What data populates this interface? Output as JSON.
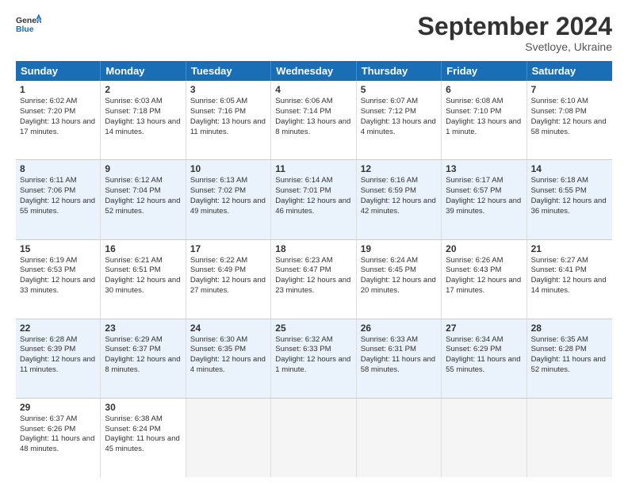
{
  "header": {
    "logo_text_general": "General",
    "logo_text_blue": "Blue",
    "month_title": "September 2024",
    "subtitle": "Svetloye, Ukraine"
  },
  "calendar": {
    "days_of_week": [
      "Sunday",
      "Monday",
      "Tuesday",
      "Wednesday",
      "Thursday",
      "Friday",
      "Saturday"
    ],
    "rows": [
      [
        {
          "day": "1",
          "info": "Sunrise: 6:02 AM\nSunset: 7:20 PM\nDaylight: 13 hours and 17 minutes."
        },
        {
          "day": "2",
          "info": "Sunrise: 6:03 AM\nSunset: 7:18 PM\nDaylight: 13 hours and 14 minutes."
        },
        {
          "day": "3",
          "info": "Sunrise: 6:05 AM\nSunset: 7:16 PM\nDaylight: 13 hours and 11 minutes."
        },
        {
          "day": "4",
          "info": "Sunrise: 6:06 AM\nSunset: 7:14 PM\nDaylight: 13 hours and 8 minutes."
        },
        {
          "day": "5",
          "info": "Sunrise: 6:07 AM\nSunset: 7:12 PM\nDaylight: 13 hours and 4 minutes."
        },
        {
          "day": "6",
          "info": "Sunrise: 6:08 AM\nSunset: 7:10 PM\nDaylight: 13 hours and 1 minute."
        },
        {
          "day": "7",
          "info": "Sunrise: 6:10 AM\nSunset: 7:08 PM\nDaylight: 12 hours and 58 minutes."
        }
      ],
      [
        {
          "day": "8",
          "info": "Sunrise: 6:11 AM\nSunset: 7:06 PM\nDaylight: 12 hours and 55 minutes."
        },
        {
          "day": "9",
          "info": "Sunrise: 6:12 AM\nSunset: 7:04 PM\nDaylight: 12 hours and 52 minutes."
        },
        {
          "day": "10",
          "info": "Sunrise: 6:13 AM\nSunset: 7:02 PM\nDaylight: 12 hours and 49 minutes."
        },
        {
          "day": "11",
          "info": "Sunrise: 6:14 AM\nSunset: 7:01 PM\nDaylight: 12 hours and 46 minutes."
        },
        {
          "day": "12",
          "info": "Sunrise: 6:16 AM\nSunset: 6:59 PM\nDaylight: 12 hours and 42 minutes."
        },
        {
          "day": "13",
          "info": "Sunrise: 6:17 AM\nSunset: 6:57 PM\nDaylight: 12 hours and 39 minutes."
        },
        {
          "day": "14",
          "info": "Sunrise: 6:18 AM\nSunset: 6:55 PM\nDaylight: 12 hours and 36 minutes."
        }
      ],
      [
        {
          "day": "15",
          "info": "Sunrise: 6:19 AM\nSunset: 6:53 PM\nDaylight: 12 hours and 33 minutes."
        },
        {
          "day": "16",
          "info": "Sunrise: 6:21 AM\nSunset: 6:51 PM\nDaylight: 12 hours and 30 minutes."
        },
        {
          "day": "17",
          "info": "Sunrise: 6:22 AM\nSunset: 6:49 PM\nDaylight: 12 hours and 27 minutes."
        },
        {
          "day": "18",
          "info": "Sunrise: 6:23 AM\nSunset: 6:47 PM\nDaylight: 12 hours and 23 minutes."
        },
        {
          "day": "19",
          "info": "Sunrise: 6:24 AM\nSunset: 6:45 PM\nDaylight: 12 hours and 20 minutes."
        },
        {
          "day": "20",
          "info": "Sunrise: 6:26 AM\nSunset: 6:43 PM\nDaylight: 12 hours and 17 minutes."
        },
        {
          "day": "21",
          "info": "Sunrise: 6:27 AM\nSunset: 6:41 PM\nDaylight: 12 hours and 14 minutes."
        }
      ],
      [
        {
          "day": "22",
          "info": "Sunrise: 6:28 AM\nSunset: 6:39 PM\nDaylight: 12 hours and 11 minutes."
        },
        {
          "day": "23",
          "info": "Sunrise: 6:29 AM\nSunset: 6:37 PM\nDaylight: 12 hours and 8 minutes."
        },
        {
          "day": "24",
          "info": "Sunrise: 6:30 AM\nSunset: 6:35 PM\nDaylight: 12 hours and 4 minutes."
        },
        {
          "day": "25",
          "info": "Sunrise: 6:32 AM\nSunset: 6:33 PM\nDaylight: 12 hours and 1 minute."
        },
        {
          "day": "26",
          "info": "Sunrise: 6:33 AM\nSunset: 6:31 PM\nDaylight: 11 hours and 58 minutes."
        },
        {
          "day": "27",
          "info": "Sunrise: 6:34 AM\nSunset: 6:29 PM\nDaylight: 11 hours and 55 minutes."
        },
        {
          "day": "28",
          "info": "Sunrise: 6:35 AM\nSunset: 6:28 PM\nDaylight: 11 hours and 52 minutes."
        }
      ],
      [
        {
          "day": "29",
          "info": "Sunrise: 6:37 AM\nSunset: 6:26 PM\nDaylight: 11 hours and 48 minutes."
        },
        {
          "day": "30",
          "info": "Sunrise: 6:38 AM\nSunset: 6:24 PM\nDaylight: 11 hours and 45 minutes."
        },
        {
          "day": "",
          "info": ""
        },
        {
          "day": "",
          "info": ""
        },
        {
          "day": "",
          "info": ""
        },
        {
          "day": "",
          "info": ""
        },
        {
          "day": "",
          "info": ""
        }
      ]
    ]
  }
}
